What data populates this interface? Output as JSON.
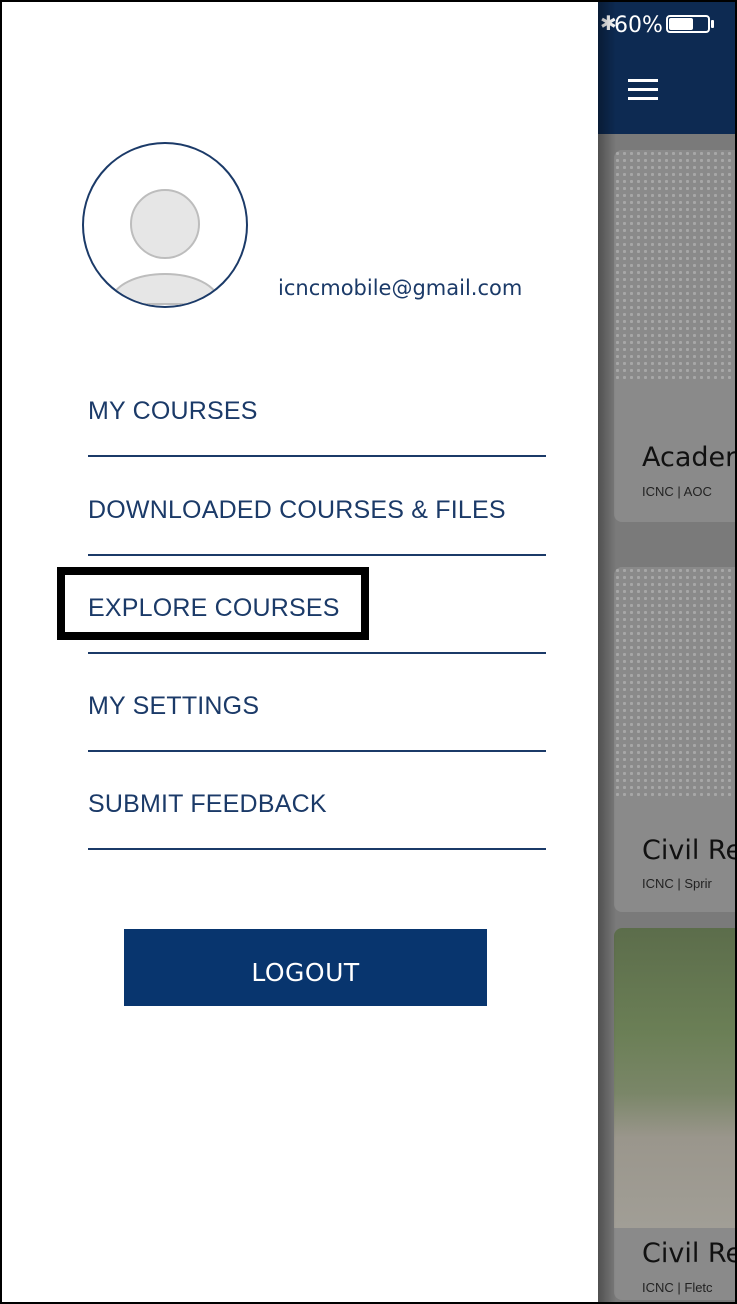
{
  "status_bar": {
    "bluetooth_icon": "bluetooth-icon",
    "battery_percent": "60%",
    "battery_level": 0.6
  },
  "app_bar": {
    "menu_icon": "hamburger-menu-icon"
  },
  "drawer": {
    "avatar_icon": "user-avatar-placeholder-icon",
    "email": "icncmobile@gmail.com",
    "menu": [
      {
        "label": "MY COURSES"
      },
      {
        "label": "DOWNLOADED COURSES & FILES"
      },
      {
        "label": "EXPLORE COURSES",
        "highlighted": true
      },
      {
        "label": "MY SETTINGS"
      },
      {
        "label": "SUBMIT FEEDBACK"
      }
    ],
    "logout_label": "LOGOUT"
  },
  "course_cards": [
    {
      "title": "Acader",
      "subtitle": "ICNC | AOC"
    },
    {
      "title": "Civil Re",
      "subtitle": "ICNC | Sprir"
    },
    {
      "title": "Civil Re",
      "subtitle": "ICNC | Fletc"
    }
  ],
  "colors": {
    "primary_navy": "#08356e",
    "text_navy": "#1b3a68",
    "appbar": "#0d2a52"
  }
}
